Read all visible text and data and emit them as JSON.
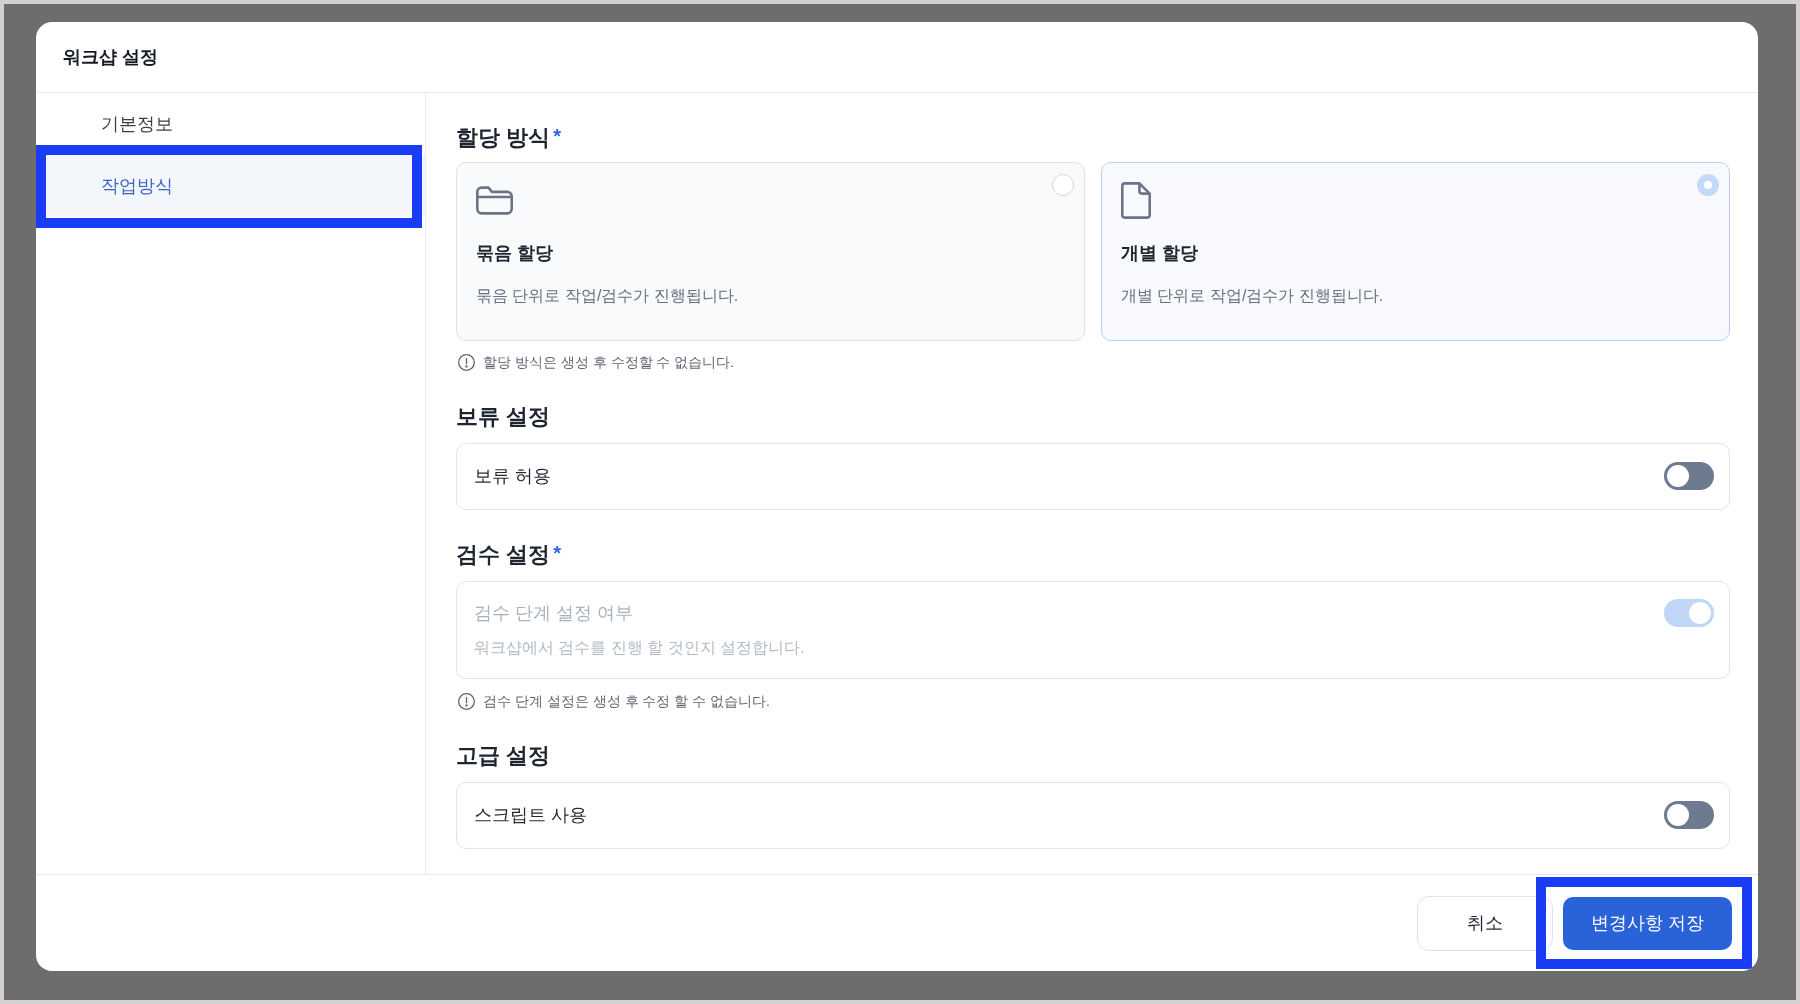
{
  "dialog": {
    "title": "워크샵 설정"
  },
  "sidebar": {
    "items": [
      {
        "label": "기본정보",
        "selected": false,
        "highlighted": false
      },
      {
        "label": "작업방식",
        "selected": true,
        "highlighted": true
      }
    ]
  },
  "sections": [
    {
      "kind": "cards",
      "title": "할당 방식",
      "mark": "*",
      "options": [
        {
          "kind": "bundle",
          "title": "묶음 할당",
          "description": "묶음 단위로 작업/검수가 진행됩니다.",
          "selected": false
        },
        {
          "kind": "single",
          "title": "개별 할당",
          "description": "개별 단위로 작업/검수가 진행됩니다.",
          "selected": true
        }
      ],
      "note": "할당 방식은 생성 후 수정할 수 없습니다."
    },
    {
      "kind": "toggles",
      "title": "보류 설정",
      "rows": [
        {
          "label": "보류 허용",
          "on": false,
          "disabled": false
        }
      ]
    },
    {
      "kind": "toggles",
      "title": "검수 설정",
      "mark": "*",
      "rows": [
        {
          "label": "검수 단계 설정 여부",
          "description": "워크샵에서 검수를 진행 할 것인지 설정합니다.",
          "on": true,
          "disabled": true
        }
      ],
      "note": "검수 단계 설정은 생성 후 수정 할 수 없습니다."
    },
    {
      "kind": "toggles",
      "title": "고급 설정",
      "rows": [
        {
          "label": "스크립트 사용",
          "on": false,
          "disabled": false
        }
      ]
    }
  ],
  "footer": {
    "buttons": [
      {
        "label": "취소",
        "kind": "secondary",
        "highlighted": false
      },
      {
        "label": "변경사항 저장",
        "kind": "primary",
        "highlighted": true
      }
    ]
  }
}
